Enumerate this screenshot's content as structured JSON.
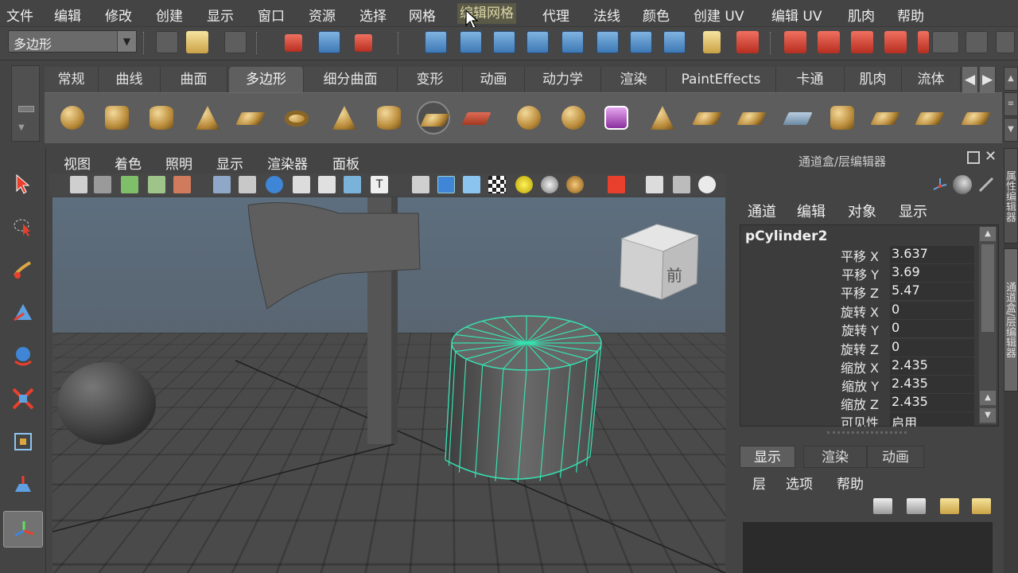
{
  "menubar": {
    "items": [
      "文件",
      "编辑",
      "修改",
      "创建",
      "显示",
      "窗口",
      "资源",
      "选择",
      "网格",
      "编辑网格",
      "代理",
      "法线",
      "颜色",
      "创建 UV",
      "编辑 UV",
      "肌肉",
      "帮助"
    ],
    "highlighted": "编辑网格"
  },
  "statusline": {
    "mode_value": "多边形"
  },
  "shelf": {
    "tabs": [
      "常规",
      "曲线",
      "曲面",
      "多边形",
      "细分曲面",
      "变形",
      "动画",
      "动力学",
      "渲染",
      "PaintEffects",
      "卡通",
      "肌肉",
      "流体"
    ],
    "active_tab": "多边形"
  },
  "viewport": {
    "menu": [
      "视图",
      "着色",
      "照明",
      "显示",
      "渲染器",
      "面板"
    ],
    "view_cube_label": "前"
  },
  "right_panel": {
    "title": "通道盒/层编辑器",
    "channel_menu": [
      "通道",
      "编辑",
      "对象",
      "显示"
    ],
    "object_name": "pCylinder2",
    "attributes": [
      {
        "label": "平移 X",
        "value": "3.637"
      },
      {
        "label": "平移 Y",
        "value": "3.69"
      },
      {
        "label": "平移 Z",
        "value": "5.47"
      },
      {
        "label": "旋转 X",
        "value": "0"
      },
      {
        "label": "旋转 Y",
        "value": "0"
      },
      {
        "label": "旋转 Z",
        "value": "0"
      },
      {
        "label": "缩放 X",
        "value": "2.435"
      },
      {
        "label": "缩放 Y",
        "value": "2.435"
      },
      {
        "label": "缩放 Z",
        "value": "2.435"
      },
      {
        "label": "可见性",
        "value": "启用"
      }
    ],
    "layer_tabs": [
      "显示",
      "渲染",
      "动画"
    ],
    "layer_active_tab": "显示",
    "layer_menu": [
      "层",
      "选项",
      "帮助"
    ],
    "vertical_tabs": [
      "属性编辑器",
      "通道盒/层编辑器"
    ]
  },
  "colors": {
    "selection_wire": "#37e0b0",
    "menu_highlight": "#5a5a47"
  }
}
